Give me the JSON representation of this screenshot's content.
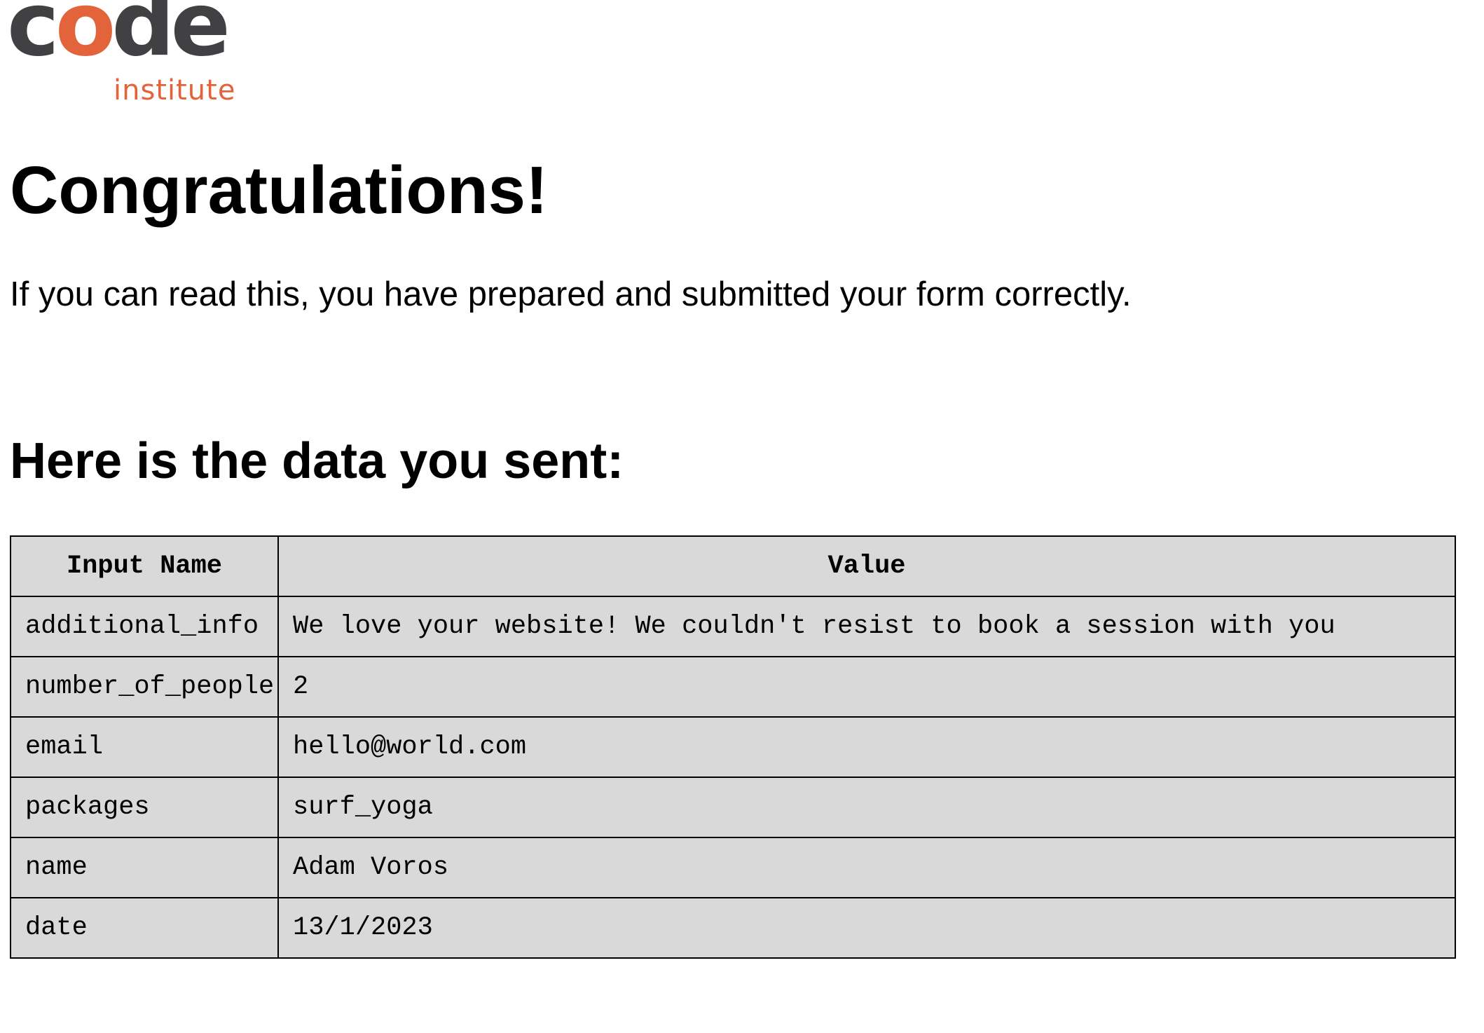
{
  "logo": {
    "word_pre": "c",
    "word_o": "o",
    "word_post": "de",
    "sub": "institute",
    "colors": {
      "dark": "#414144",
      "accent": "#e3643b"
    }
  },
  "page_title": "Congratulations!",
  "lead_text": "If you can read this, you have prepared and submitted your form correctly.",
  "section_title": "Here is the data you sent:",
  "table": {
    "headers": [
      "Input Name",
      "Value"
    ],
    "rows": [
      {
        "name": "additional_info",
        "value": "We love your website! We couldn't resist to book a session with you"
      },
      {
        "name": "number_of_people",
        "value": "2"
      },
      {
        "name": "email",
        "value": "hello@world.com"
      },
      {
        "name": "packages",
        "value": "surf_yoga"
      },
      {
        "name": "name",
        "value": "Adam Voros"
      },
      {
        "name": "date",
        "value": "13/1/2023"
      }
    ]
  },
  "colors": {
    "table_bg": "#d9d9d9",
    "border": "#000000"
  }
}
